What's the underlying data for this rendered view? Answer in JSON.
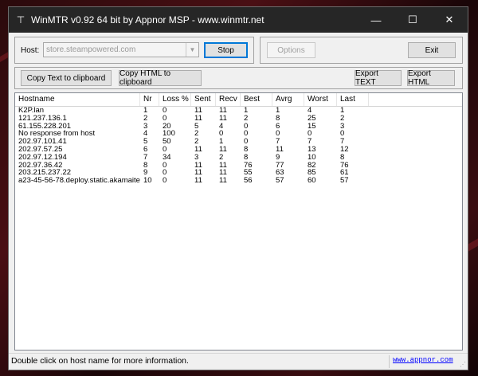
{
  "window": {
    "title": "WinMTR v0.92 64 bit by Appnor MSP - www.winmtr.net",
    "controls": {
      "minimize": "—",
      "maximize": "☐",
      "close": "✕"
    }
  },
  "host": {
    "label": "Host:",
    "value": "store.steampowered.com"
  },
  "buttons": {
    "stop": "Stop",
    "options": "Options",
    "exit": "Exit",
    "copy_text": "Copy Text to clipboard",
    "copy_html": "Copy HTML to clipboard",
    "export_text": "Export TEXT",
    "export_html": "Export HTML"
  },
  "table": {
    "columns": [
      "Hostname",
      "Nr",
      "Loss %",
      "Sent",
      "Recv",
      "Best",
      "Avrg",
      "Worst",
      "Last"
    ],
    "rows": [
      [
        "K2P.lan",
        "1",
        "0",
        "11",
        "11",
        "1",
        "1",
        "4",
        "1"
      ],
      [
        "121.237.136.1",
        "2",
        "0",
        "11",
        "11",
        "2",
        "8",
        "25",
        "2"
      ],
      [
        "61.155.228.201",
        "3",
        "20",
        "5",
        "4",
        "0",
        "6",
        "15",
        "3"
      ],
      [
        "No response from host",
        "4",
        "100",
        "2",
        "0",
        "0",
        "0",
        "0",
        "0"
      ],
      [
        "202.97.101.41",
        "5",
        "50",
        "2",
        "1",
        "0",
        "7",
        "7",
        "7"
      ],
      [
        "202.97.57.25",
        "6",
        "0",
        "11",
        "11",
        "8",
        "11",
        "13",
        "12"
      ],
      [
        "202.97.12.194",
        "7",
        "34",
        "3",
        "2",
        "8",
        "9",
        "10",
        "8"
      ],
      [
        "202.97.36.42",
        "8",
        "0",
        "11",
        "11",
        "76",
        "77",
        "82",
        "76"
      ],
      [
        "203.215.237.22",
        "9",
        "0",
        "11",
        "11",
        "55",
        "63",
        "85",
        "61"
      ],
      [
        "a23-45-56-78.deploy.static.akamaite...",
        "10",
        "0",
        "11",
        "11",
        "56",
        "57",
        "60",
        "57"
      ]
    ]
  },
  "status": {
    "message": "Double click on host name for more information.",
    "link": "www.appnor.com"
  }
}
